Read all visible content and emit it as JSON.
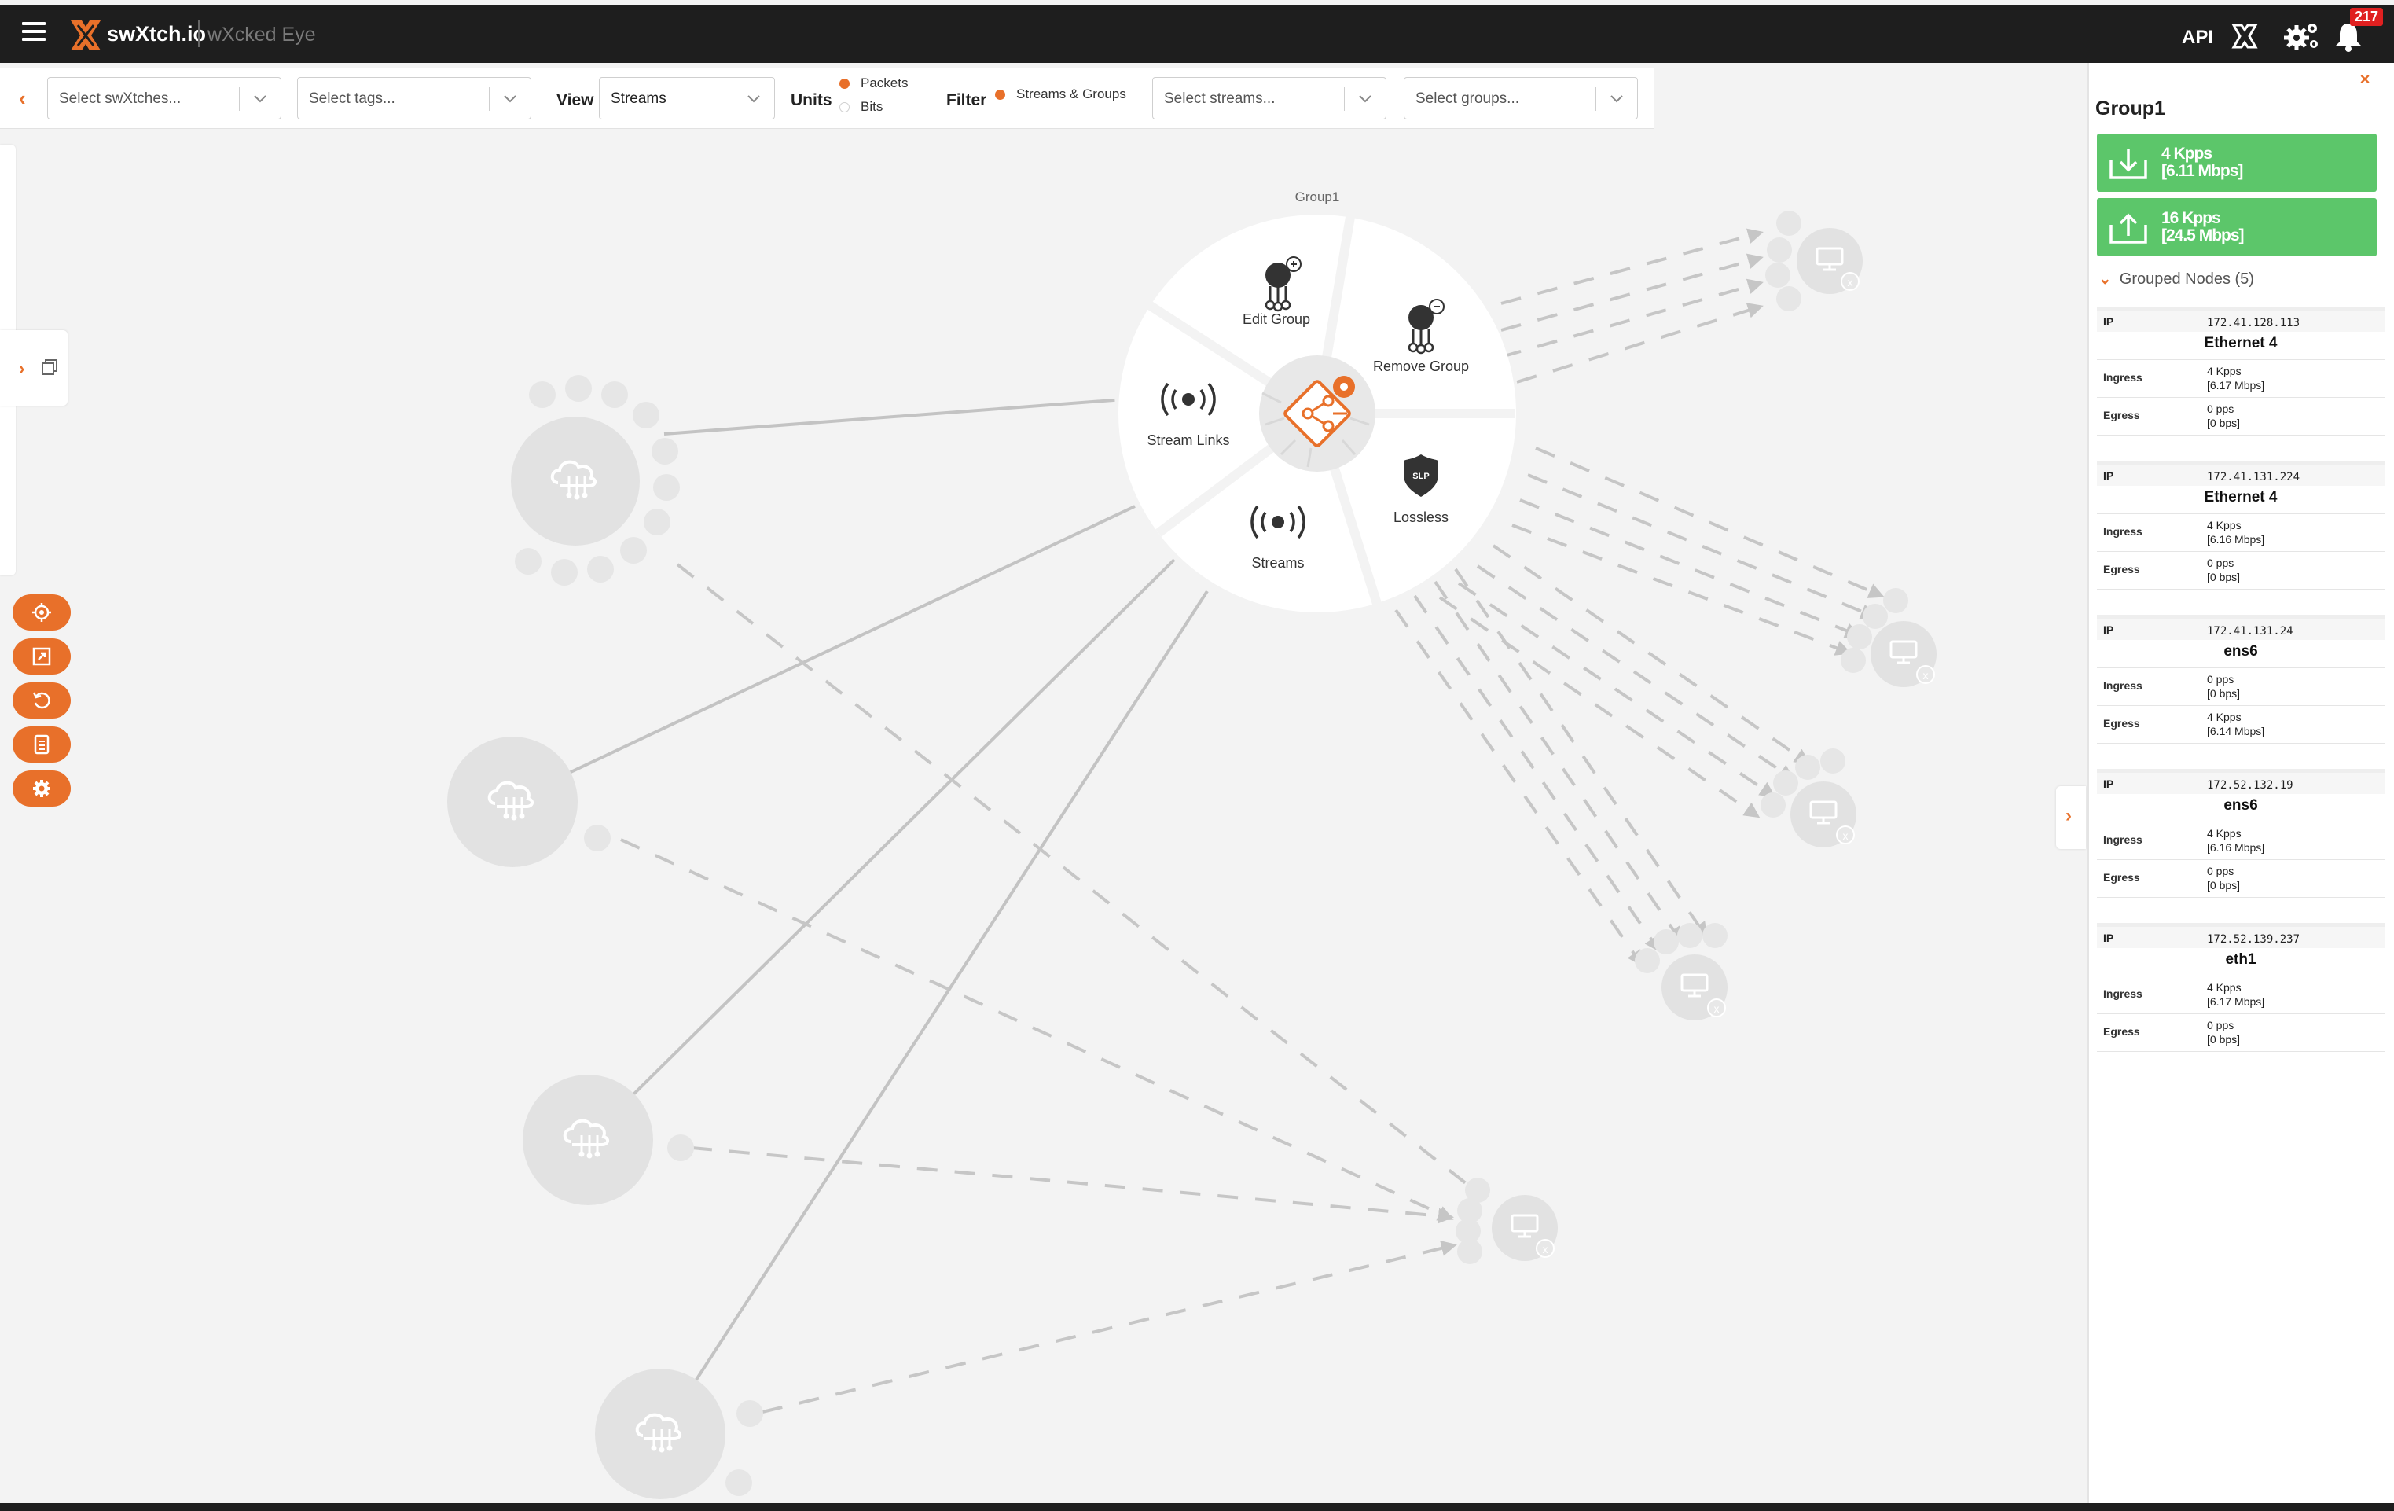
{
  "header": {
    "brand": "swXtch.io",
    "product": "wXcked Eye",
    "api_label": "API",
    "notification_count": "217",
    "accent_color": "#e8702a"
  },
  "toolbar": {
    "switches_placeholder": "Select swXtches...",
    "tags_placeholder": "Select tags...",
    "view_label": "View",
    "view_value": "Streams",
    "units_label": "Units",
    "units_options": [
      {
        "label": "Packets",
        "selected": true
      },
      {
        "label": "Bits",
        "selected": false
      }
    ],
    "filter_label": "Filter",
    "filter_option": "Streams & Groups",
    "streams_placeholder": "Select streams...",
    "groups_placeholder": "Select groups..."
  },
  "graph": {
    "group_label": "Group1",
    "menu": {
      "edit_group": "Edit Group",
      "remove_group": "Remove Group",
      "stream_links": "Stream Links",
      "streams": "Streams",
      "lossless": "Lossless",
      "lossless_badge": "SLP"
    }
  },
  "panel": {
    "title": "Group1",
    "ingress_rate": {
      "line1": "4 Kpps",
      "line2": "[6.11 Mbps]"
    },
    "egress_rate": {
      "line1": "16 Kpps",
      "line2": "[24.5 Mbps]"
    },
    "grouped_nodes_label": "Grouped Nodes (5)",
    "labels": {
      "ip": "IP",
      "ingress": "Ingress",
      "egress": "Egress"
    },
    "nodes": [
      {
        "ip": "172.41.128.113",
        "iface": "Ethernet 4",
        "ingress": [
          "4 Kpps",
          "[6.17 Mbps]"
        ],
        "egress": [
          "0 pps",
          "[0 bps]"
        ]
      },
      {
        "ip": "172.41.131.224",
        "iface": "Ethernet 4",
        "ingress": [
          "4 Kpps",
          "[6.16 Mbps]"
        ],
        "egress": [
          "0 pps",
          "[0 bps]"
        ]
      },
      {
        "ip": "172.41.131.24",
        "iface": "ens6",
        "ingress": [
          "0 pps",
          "[0 bps]"
        ],
        "egress": [
          "4 Kpps",
          "[6.14 Mbps]"
        ]
      },
      {
        "ip": "172.52.132.19",
        "iface": "ens6",
        "ingress": [
          "4 Kpps",
          "[6.16 Mbps]"
        ],
        "egress": [
          "0 pps",
          "[0 bps]"
        ]
      },
      {
        "ip": "172.52.139.237",
        "iface": "eth1",
        "ingress": [
          "4 Kpps",
          "[6.17 Mbps]"
        ],
        "egress": [
          "0 pps",
          "[0 bps]"
        ]
      }
    ]
  },
  "icons": [
    "menu-icon",
    "swxtch-logo-icon",
    "x-icon",
    "settings-icon",
    "bell-icon",
    "chevron-down-icon",
    "copy-icon",
    "target-icon",
    "expand-icon",
    "reset-icon",
    "document-icon",
    "gear-icon",
    "download-icon",
    "upload-icon",
    "broadcast-icon",
    "cloud-network-icon",
    "monitor-icon",
    "shield-icon"
  ]
}
